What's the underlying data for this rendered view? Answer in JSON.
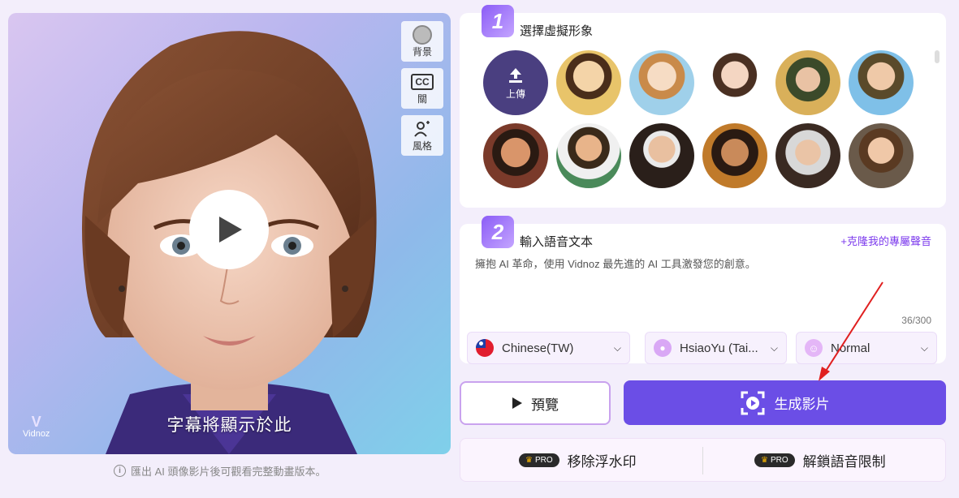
{
  "preview": {
    "tools": [
      {
        "label": "背景",
        "icon": "background-icon"
      },
      {
        "label": "關",
        "icon": "cc-icon"
      },
      {
        "label": "風格",
        "icon": "style-icon"
      }
    ],
    "subtitle": "字幕將顯示於此",
    "logo": "Vidnoz",
    "notice": "匯出 AI 頭像影片後可觀看完整動畫版本。"
  },
  "step1": {
    "number": "1",
    "title": "選擇虛擬形象",
    "upload_label": "上傳"
  },
  "step2": {
    "number": "2",
    "title": "輸入語音文本",
    "clone_link": "克隆我的專屬聲音",
    "script": "擁抱 AI 革命，使用 Vidnoz 最先進的 AI 工具激發您的創意。",
    "counter": "36/300",
    "language": "Chinese(TW)",
    "voice": "HsiaoYu (Tai...",
    "mood": "Normal"
  },
  "actions": {
    "preview_label": "預覽",
    "generate_label": "生成影片"
  },
  "pro": {
    "badge": "PRO",
    "remove_watermark": "移除浮水印",
    "unlock_voice": "解鎖語音限制"
  },
  "colors": {
    "accent": "#6b4ee6",
    "link": "#7c3aed",
    "annotation_arrow": "#e02020"
  }
}
